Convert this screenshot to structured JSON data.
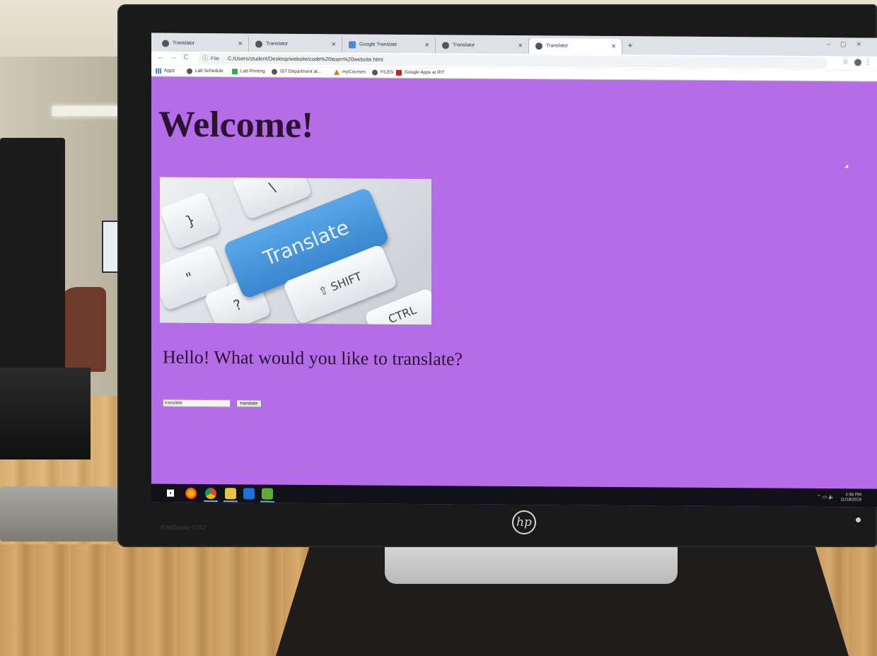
{
  "browser": {
    "tabs": [
      {
        "title": "Translator",
        "icon": "globe-icon",
        "active": false
      },
      {
        "title": "Translator",
        "icon": "globe-icon",
        "active": false
      },
      {
        "title": "Google Translate",
        "icon": "google-translate-icon",
        "active": false
      },
      {
        "title": "Translator",
        "icon": "globe-icon",
        "active": false
      },
      {
        "title": "Translator",
        "icon": "globe-icon",
        "active": true
      }
    ],
    "new_tab": "+",
    "address": {
      "scheme_label": "File",
      "url": "C:/Users/student/Desktop/website/code%20team%20website.html"
    },
    "bookmarks": [
      {
        "label": "Apps",
        "icon": "apps-icon"
      },
      {
        "label": "Lab Schedule",
        "icon": "calendar-icon"
      },
      {
        "label": "Lab Printing",
        "icon": "flag-icon"
      },
      {
        "label": "IST Department at...",
        "icon": "globe-icon"
      },
      {
        "label": "myCourses",
        "icon": "triangle-icon"
      },
      {
        "label": "FILES",
        "icon": "globe-icon"
      },
      {
        "label": "Google Apps at RIT",
        "icon": "rit-icon"
      }
    ]
  },
  "page": {
    "heading": "Welcome!",
    "image": {
      "key_label": "Translate",
      "shift_label": "⇧ SHIFT",
      "ctrl_label": "CTRL",
      "key_symbols": [
        "}",
        "]",
        "\\",
        "\"",
        "?"
      ]
    },
    "prompt": "Hello! What would you like to translate?",
    "input_value": "translate",
    "button_label": "translate",
    "background_color": "#b46ce6"
  },
  "taskbar": {
    "time": "2:56 PM",
    "date": "11/18/2019"
  },
  "monitor": {
    "brand": "hp",
    "model": "EliteDisplay E242"
  }
}
